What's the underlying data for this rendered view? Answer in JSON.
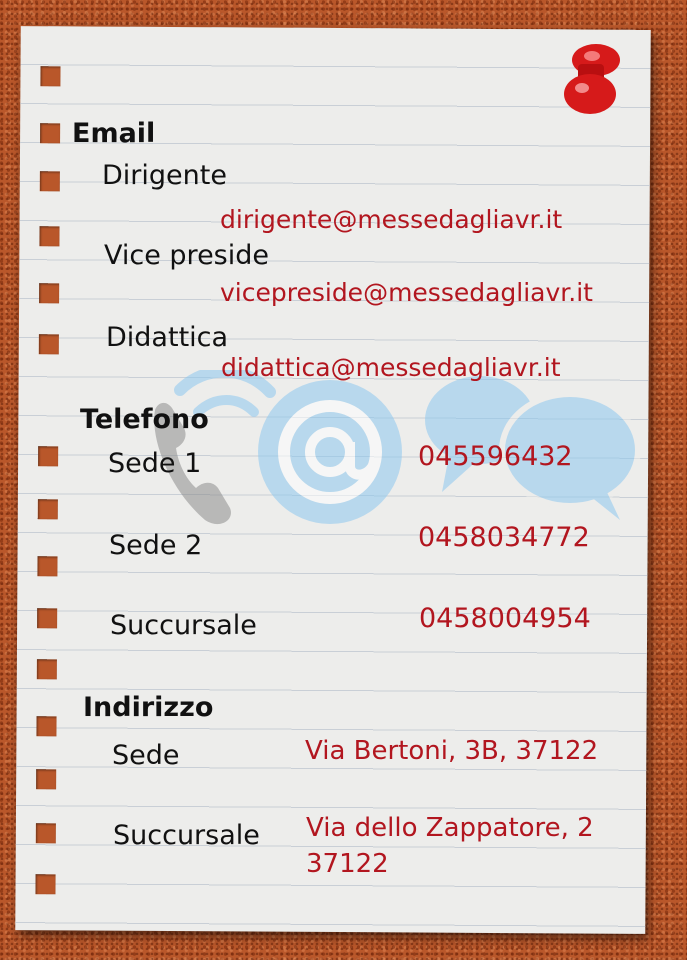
{
  "sections": {
    "email": {
      "heading": "Email",
      "rows": [
        {
          "label": "Dirigente",
          "value": "dirigente@messedagliavr.it"
        },
        {
          "label": "Vice preside",
          "value": "vicepreside@messedagliavr.it"
        },
        {
          "label": "Didattica",
          "value": "didattica@messedagliavr.it"
        }
      ]
    },
    "telefono": {
      "heading": "Telefono",
      "rows": [
        {
          "label": "Sede 1",
          "value": "045596432"
        },
        {
          "label": "Sede 2",
          "value": "0458034772"
        },
        {
          "label": "Succursale",
          "value": "0458004954"
        }
      ]
    },
    "indirizzo": {
      "heading": "Indirizzo",
      "rows": [
        {
          "label": "Sede",
          "value": "Via Bertoni, 3B, 37122"
        },
        {
          "label": "Succursale",
          "value": "Via dello Zappatore, 2 37122"
        }
      ]
    }
  },
  "colors": {
    "cork": "#b9572a",
    "paper": "#ededeb",
    "value_red": "#b2161f",
    "icon_blue": "#8ec8ef",
    "pin_red": "#d61a1a"
  },
  "decor": {
    "pin_icon": "push-pin-icon",
    "background_icons": [
      "phone-icon",
      "at-sign-icon",
      "chat-bubbles-icon"
    ]
  }
}
